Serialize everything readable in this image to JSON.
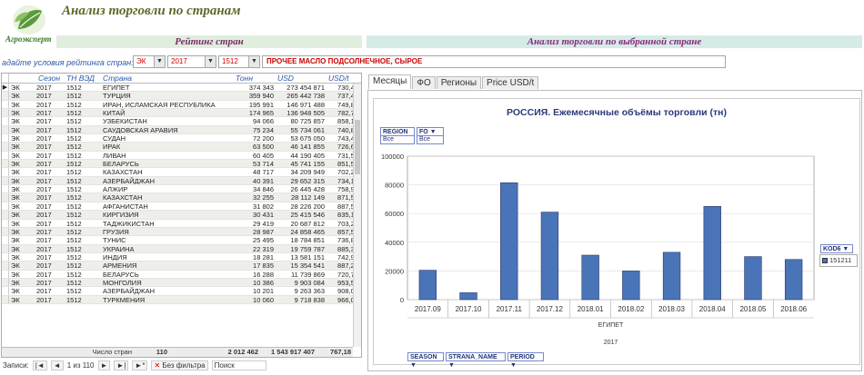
{
  "app": {
    "title": "Анализ торговли по странам",
    "logo_text": "Агроэксперт"
  },
  "bands": {
    "left": "Рейтинг стран",
    "right": "Анализ торговли по выбранной стране"
  },
  "conditions": {
    "label": "адайте условия рейтинга стран:",
    "flow": "ЭК",
    "year": "2017",
    "code": "1512",
    "product": "ПРОЧЕЕ МАСЛО ПОДСОЛНЕЧНОЕ, СЫРОЕ"
  },
  "grid": {
    "headers": [
      "Сезон",
      "ТН ВЭД",
      "Страна",
      "Тонн",
      "USD",
      "USD/t"
    ],
    "rows": [
      [
        "ЭК",
        "2017",
        "1512",
        "ЕГИПЕТ",
        "374 343",
        "273 454 871",
        "730,49"
      ],
      [
        "ЭК",
        "2017",
        "1512",
        "ТУРЦИЯ",
        "359 940",
        "265 442 738",
        "737,46"
      ],
      [
        "ЭК",
        "2017",
        "1512",
        "ИРАН, ИСЛАМСКАЯ РЕСПУБЛИКА",
        "195 991",
        "146 971 488",
        "749,89"
      ],
      [
        "ЭК",
        "2017",
        "1512",
        "КИТАЙ",
        "174 965",
        "136 948 505",
        "782,72"
      ],
      [
        "ЭК",
        "2017",
        "1512",
        "УЗБЕКИСТАН",
        "94 066",
        "80 725 857",
        "858,18"
      ],
      [
        "ЭК",
        "2017",
        "1512",
        "САУДОВСКАЯ АРАВИЯ",
        "75 234",
        "55 734 061",
        "740,81"
      ],
      [
        "ЭК",
        "2017",
        "1512",
        "СУДАН",
        "72 200",
        "53 675 050",
        "743,42"
      ],
      [
        "ЭК",
        "2017",
        "1512",
        "ИРАК",
        "63 500",
        "46 141 855",
        "726,64"
      ],
      [
        "ЭК",
        "2017",
        "1512",
        "ЛИВАН",
        "60 405",
        "44 190 405",
        "731,57"
      ],
      [
        "ЭК",
        "2017",
        "1512",
        "БЕЛАРУСЬ",
        "53 714",
        "45 741 155",
        "851,56"
      ],
      [
        "ЭК",
        "2017",
        "1512",
        "КАЗАХСТАН",
        "48 717",
        "34 209 949",
        "702,22"
      ],
      [
        "ЭК",
        "2017",
        "1512",
        "АЗЕРБАЙДЖАН",
        "40 391",
        "29 652 315",
        "734,13"
      ],
      [
        "ЭК",
        "2017",
        "1512",
        "АЛЖИР",
        "34 846",
        "26 445 428",
        "758,92"
      ],
      [
        "ЭК",
        "2017",
        "1512",
        "КАЗАХСТАН",
        "32 255",
        "28 112 149",
        "871,55"
      ],
      [
        "ЭК",
        "2017",
        "1512",
        "АФГАНИСТАН",
        "31 802",
        "28 226 200",
        "887,57"
      ],
      [
        "ЭК",
        "2017",
        "1512",
        "КИРГИЗИЯ",
        "30 431",
        "25 415 546",
        "835,18"
      ],
      [
        "ЭК",
        "2017",
        "1512",
        "ТАДЖИКИСТАН",
        "29 419",
        "20 687 812",
        "703,21"
      ],
      [
        "ЭК",
        "2017",
        "1512",
        "ГРУЗИЯ",
        "28 987",
        "24 858 465",
        "857,57"
      ],
      [
        "ЭК",
        "2017",
        "1512",
        "ТУНИС",
        "25 495",
        "18 784 851",
        "736,81"
      ],
      [
        "ЭК",
        "2017",
        "1512",
        "УКРАИНА",
        "22 319",
        "19 759 787",
        "885,32"
      ],
      [
        "ЭК",
        "2017",
        "1512",
        "ИНДИЯ",
        "18 281",
        "13 581 151",
        "742,91"
      ],
      [
        "ЭК",
        "2017",
        "1512",
        "АРМЕНИЯ",
        "17 835",
        "15 354 541",
        "887,27"
      ],
      [
        "ЭК",
        "2017",
        "1512",
        "БЕЛАРУСЬ",
        "16 288",
        "11 739 869",
        "720,75"
      ],
      [
        "ЭК",
        "2017",
        "1512",
        "МОНГОЛИЯ",
        "10 386",
        "9 903 084",
        "953,52"
      ],
      [
        "ЭК",
        "2017",
        "1512",
        "АЗЕРБАЙДЖАН",
        "10 201",
        "9 263 363",
        "908,04"
      ],
      [
        "ЭК",
        "2017",
        "1512",
        "ТУРКМЕНИЯ",
        "10 060",
        "9 718 838",
        "966,06"
      ]
    ],
    "totals": {
      "label": "Число стран",
      "count": "110",
      "tons": "2 012 462",
      "usd": "1 543 917 407",
      "price": "767,18"
    }
  },
  "nav": {
    "label": "Записи:",
    "position": "1 из 110",
    "filter": "Без фильтра",
    "search": "Поиск"
  },
  "tabs": [
    "Месяцы",
    "ФО",
    "Регионы",
    "Price USD/t"
  ],
  "chart_fields": {
    "region": "REGION",
    "region_val": "Все",
    "fo": "FO",
    "fo_val": "Все",
    "kod": "KOD6",
    "season": "SEASON",
    "strana": "STRANA_NAME",
    "period": "PERIOD"
  },
  "chart_data": {
    "type": "bar",
    "title": "РОССИЯ. Ежемесячные объёмы торговли (тн)",
    "categories": [
      "2017.09",
      "2017.10",
      "2017.11",
      "2017.12",
      "2018.01",
      "2018.02",
      "2018.03",
      "2018.04",
      "2018.05",
      "2018.06"
    ],
    "series": [
      {
        "name": "151211",
        "values": [
          20500,
          4800,
          81500,
          61000,
          31000,
          20000,
          33000,
          65000,
          30000,
          28000
        ]
      }
    ],
    "ylim": [
      0,
      100000
    ],
    "yticks": [
      0,
      20000,
      40000,
      60000,
      80000,
      100000
    ],
    "x_group_label": "ЕГИПЕТ",
    "x_sub_label": "2017",
    "color": "#4a74b8"
  }
}
